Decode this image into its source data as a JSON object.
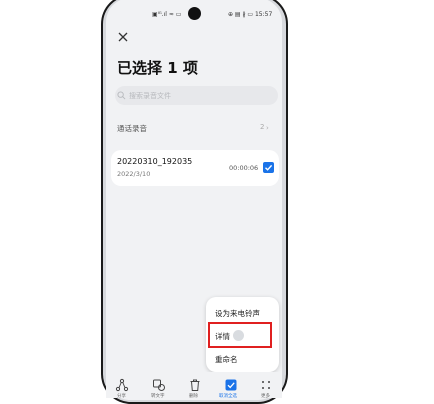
{
  "colors": {
    "accent": "#1a73e8",
    "highlight": "#e02020",
    "screen_bg": "#f1f2f4"
  },
  "status_bar": {
    "left_text": "▣ᴵᴳ.ıl ≈ ▭",
    "right_text": "⊕ ▤ ∦ ▭ 15:57"
  },
  "header": {
    "close_icon": "close-icon",
    "title": "已选择 1 项"
  },
  "search": {
    "icon": "search-icon",
    "placeholder": "搜索录音文件"
  },
  "section": {
    "title": "通话录音",
    "count": "2",
    "chevron": "›"
  },
  "recording": {
    "name": "20220310_192035",
    "date": "2022/3/10",
    "duration": "00:00:06",
    "checked": true
  },
  "popup_menu": {
    "items": [
      "设为来电铃声",
      "详情",
      "重命名"
    ],
    "highlighted_index": 1
  },
  "bottom_toolbar": {
    "items": [
      {
        "icon": "share-icon",
        "label": "分享"
      },
      {
        "icon": "convert-icon",
        "label": "转文字"
      },
      {
        "icon": "trash-icon",
        "label": "删除"
      },
      {
        "icon": "select-all-icon",
        "label": "取消全选"
      },
      {
        "icon": "more-icon",
        "label": "更多"
      }
    ]
  }
}
